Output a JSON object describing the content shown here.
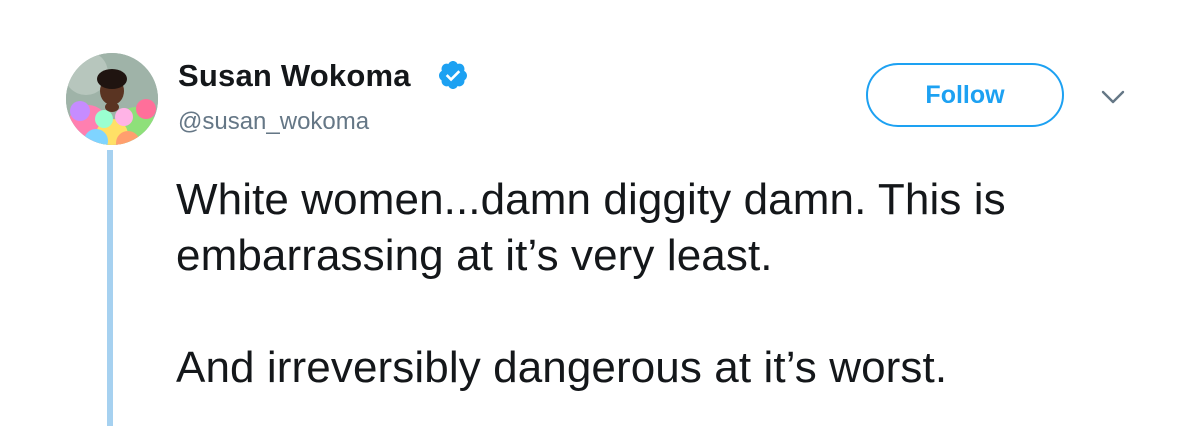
{
  "tweet": {
    "author": {
      "display_name": "Susan Wokoma",
      "handle": "@susan_wokoma",
      "verified": true,
      "avatar_icon": "profile-photo"
    },
    "follow_label": "Follow",
    "menu_icon": "chevron-down-icon",
    "text": {
      "paragraph_1": "White women...damn diggity damn. This is embarrassing at it’s very least.",
      "paragraph_2": "And irreversibly dangerous at it’s worst."
    }
  },
  "colors": {
    "accent": "#1da1f2",
    "text": "#14171a",
    "secondary_text": "#657786",
    "thread_line": "#a6d1f0"
  }
}
